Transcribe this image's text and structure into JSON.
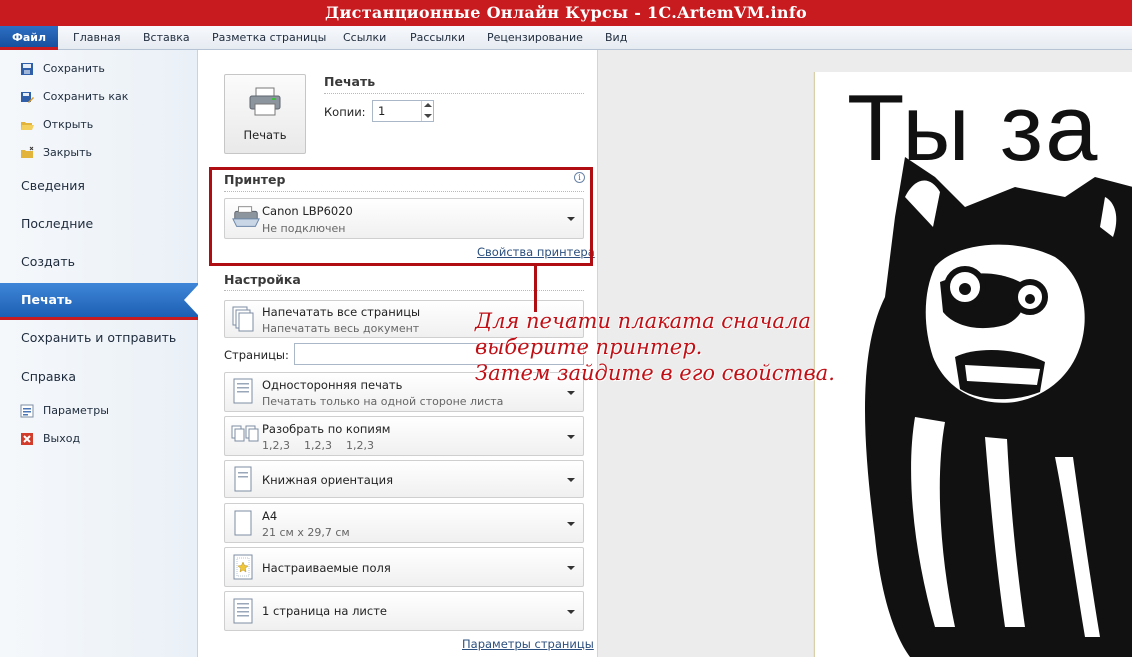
{
  "window": {
    "title": "Дистанционные Онлайн Курсы - 1C.ArtemVM.info"
  },
  "ribbon": {
    "tabs": [
      "Файл",
      "Главная",
      "Вставка",
      "Разметка страницы",
      "Ссылки",
      "Рассылки",
      "Рецензирование",
      "Вид"
    ]
  },
  "menu": {
    "save": "Сохранить",
    "save_as": "Сохранить как",
    "open": "Открыть",
    "close": "Закрыть",
    "info": "Сведения",
    "recent": "Последние",
    "new": "Создать",
    "print": "Печать",
    "send": "Сохранить и отправить",
    "help": "Справка",
    "options": "Параметры",
    "exit": "Выход"
  },
  "print": {
    "section_title": "Печать",
    "button_label": "Печать",
    "copies_label": "Копии:",
    "copies_value": "1"
  },
  "printer": {
    "section_title": "Принтер",
    "name": "Canon LBP6020",
    "status": "Не подключен",
    "properties_link": "Свойства принтера"
  },
  "settings": {
    "section_title": "Настройка",
    "pages_label": "Страницы:",
    "pages_value": "",
    "options": [
      {
        "title": "Напечатать все страницы",
        "subtitle": "Напечатать весь документ"
      },
      {
        "title": "Односторонняя печать",
        "subtitle": "Печатать только на одной стороне листа"
      },
      {
        "title": "Разобрать по копиям",
        "subtitle": "1,2,3    1,2,3    1,2,3"
      },
      {
        "title": "Книжная ориентация",
        "subtitle": ""
      },
      {
        "title": "А4",
        "subtitle": "21 см x 29,7 см"
      },
      {
        "title": "Настраиваемые поля",
        "subtitle": ""
      },
      {
        "title": "1 страница на листе",
        "subtitle": ""
      }
    ],
    "page_setup_link": "Параметры страницы"
  },
  "annotation": {
    "line1": "Для печати плаката сначала",
    "line2": "выберите принтер.",
    "line3": "Затем зайдите в его свойства."
  },
  "preview": {
    "text": "Ты за"
  },
  "colors": {
    "title_bar": "#c81b1f",
    "annotation": "#c01016",
    "active_menu": "#1c5fb3"
  }
}
